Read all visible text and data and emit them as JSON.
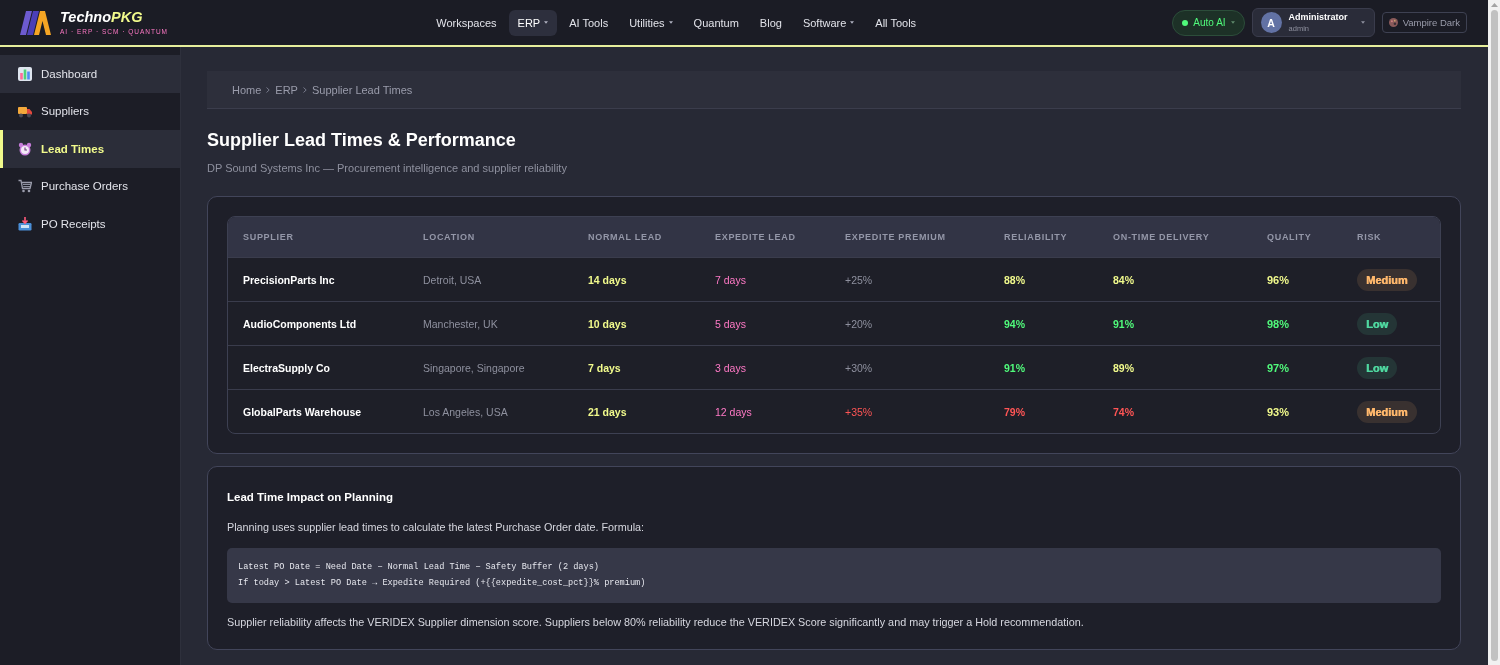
{
  "brand": {
    "name": "Techno",
    "name_accent": "PKG",
    "tagline": "AI · ERP · SCM · QUANTUM"
  },
  "nav": [
    {
      "label": "Workspaces",
      "selected": false,
      "has_menu": false
    },
    {
      "label": "ERP",
      "selected": true,
      "has_menu": true
    },
    {
      "label": "AI Tools",
      "selected": false,
      "has_menu": false
    },
    {
      "label": "Utilities",
      "selected": false,
      "has_menu": true
    },
    {
      "label": "Quantum",
      "selected": false,
      "has_menu": false
    },
    {
      "label": "Blog",
      "selected": false,
      "has_menu": false
    },
    {
      "label": "Software",
      "selected": false,
      "has_menu": true
    },
    {
      "label": "All Tools",
      "selected": false,
      "has_menu": false
    }
  ],
  "auto_ai": {
    "label": "Auto AI",
    "on": true
  },
  "user": {
    "initial": "A",
    "name": "Administrator",
    "role": "admin"
  },
  "theme_button": {
    "label": "Vampire Dark"
  },
  "sidebar": {
    "items": [
      {
        "label": "Dashboard",
        "selected": false,
        "hovered": true
      },
      {
        "label": "Suppliers",
        "selected": false,
        "hovered": false
      },
      {
        "label": "Lead Times",
        "selected": true,
        "hovered": false
      },
      {
        "label": "Purchase Orders",
        "selected": false,
        "hovered": false
      },
      {
        "label": "PO Receipts",
        "selected": false,
        "hovered": false
      }
    ]
  },
  "breadcrumb": [
    "Home",
    "ERP",
    "Supplier Lead Times"
  ],
  "header": {
    "title": "Supplier Lead Times & Performance",
    "subtitle": "DP Sound Systems Inc — Procurement intelligence and supplier reliability"
  },
  "table": {
    "columns": [
      "SUPPLIER",
      "LOCATION",
      "NORMAL LEAD",
      "EXPEDITE LEAD",
      "EXPEDITE PREMIUM",
      "RELIABILITY",
      "ON-TIME DELIVERY",
      "QUALITY",
      "RISK"
    ],
    "rows": [
      {
        "supplier": "PrecisionParts Inc",
        "location": "Detroit, USA",
        "normal_lead": "14 days",
        "expedite_lead": "7 days",
        "expedite_premium": {
          "text": "+25%",
          "color": "#8e909e"
        },
        "reliability": {
          "text": "88%",
          "color": "#f1fa8c"
        },
        "on_time_delivery": {
          "text": "84%",
          "color": "#f1fa8c"
        },
        "quality": {
          "text": "96%",
          "color": "#f1fa8c"
        },
        "risk": {
          "label": "Medium",
          "color": "#ffb86c"
        }
      },
      {
        "supplier": "AudioComponents Ltd",
        "location": "Manchester, UK",
        "normal_lead": "10 days",
        "expedite_lead": "5 days",
        "expedite_premium": {
          "text": "+20%",
          "color": "#8e909e"
        },
        "reliability": {
          "text": "94%",
          "color": "#50fa7b"
        },
        "on_time_delivery": {
          "text": "91%",
          "color": "#50fa7b"
        },
        "quality": {
          "text": "98%",
          "color": "#50fa7b"
        },
        "risk": {
          "label": "Low",
          "color": "#4fd8a0"
        }
      },
      {
        "supplier": "ElectraSupply Co",
        "location": "Singapore, Singapore",
        "normal_lead": "7 days",
        "expedite_lead": "3 days",
        "expedite_premium": {
          "text": "+30%",
          "color": "#8e909e"
        },
        "reliability": {
          "text": "91%",
          "color": "#50fa7b"
        },
        "on_time_delivery": {
          "text": "89%",
          "color": "#f1fa8c"
        },
        "quality": {
          "text": "97%",
          "color": "#50fa7b"
        },
        "risk": {
          "label": "Low",
          "color": "#4fd8a0"
        }
      },
      {
        "supplier": "GlobalParts Warehouse",
        "location": "Los Angeles, USA",
        "normal_lead": "21 days",
        "expedite_lead": "12 days",
        "expedite_premium": {
          "text": "+35%",
          "color": "#ff5555"
        },
        "reliability": {
          "text": "79%",
          "color": "#ff5555"
        },
        "on_time_delivery": {
          "text": "74%",
          "color": "#ff5555"
        },
        "quality": {
          "text": "93%",
          "color": "#f1fa8c"
        },
        "risk": {
          "label": "Medium",
          "color": "#ffb86c"
        }
      }
    ]
  },
  "planning": {
    "title": "Lead Time Impact on Planning",
    "intro": "Planning uses supplier lead times to calculate the latest Purchase Order date. Formula:",
    "code_lines": [
      "Latest PO Date = Need Date − Normal Lead Time − Safety Buffer (2 days)",
      "If today > Latest PO Date → Expedite Required (+{{expedite_cost_pct}}% premium)"
    ],
    "note": "Supplier reliability affects the VERIDEX Supplier dimension score. Suppliers below 80% reliability reduce the VERIDEX Score significantly and may trigger a Hold recommendation."
  }
}
